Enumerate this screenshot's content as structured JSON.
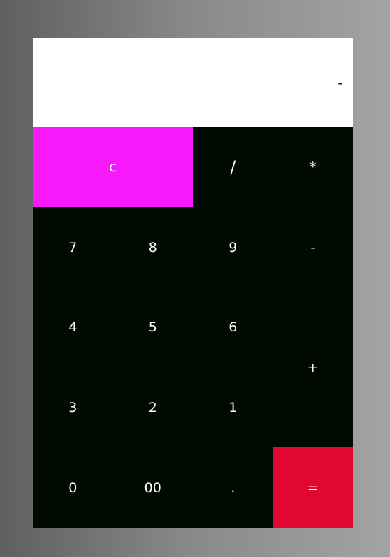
{
  "display": {
    "value": "-"
  },
  "keys": {
    "clear": "c",
    "divide": "/",
    "multiply": "*",
    "seven": "7",
    "eight": "8",
    "nine": "9",
    "minus": "-",
    "four": "4",
    "five": "5",
    "six": "6",
    "plus": "+",
    "three": "3",
    "two": "2",
    "one": "1",
    "zero": "0",
    "double_zero": "00",
    "dot": ".",
    "equals": "="
  },
  "colors": {
    "display_bg": "#ffffff",
    "keypad_bg": "#000a00",
    "clear_bg": "#f719fa",
    "equals_bg": "#e00832",
    "key_text": "#ffffff"
  }
}
